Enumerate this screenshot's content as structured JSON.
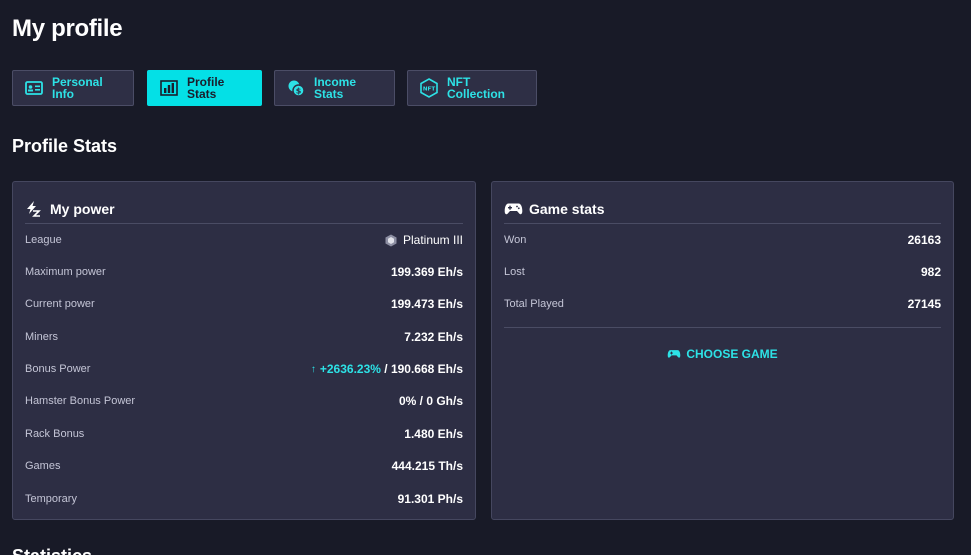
{
  "page": {
    "title": "My profile"
  },
  "tabs": [
    {
      "label": "Personal\nInfo",
      "icon": "id-card-icon",
      "active": false
    },
    {
      "label": "Profile\nStats",
      "icon": "bar-chart-icon",
      "active": true
    },
    {
      "label": "Income\nStats",
      "icon": "coins-icon",
      "active": false
    },
    {
      "label": "NFT\nCollection",
      "icon": "nft-icon",
      "active": false
    }
  ],
  "section": {
    "title": "Profile Stats"
  },
  "power": {
    "title": "My power",
    "rows": [
      {
        "label": "League",
        "value": "Platinum III"
      },
      {
        "label": "Maximum power",
        "value": "199.369 Eh/s"
      },
      {
        "label": "Current power",
        "value": "199.473 Eh/s"
      },
      {
        "label": "Miners",
        "value": "7.232 Eh/s"
      },
      {
        "label": "Bonus Power",
        "bonus_arrow": "↑",
        "bonus_percent": "+2636.23%",
        "value": " / 190.668 Eh/s"
      },
      {
        "label": "Hamster Bonus Power",
        "value": "0% / 0 Gh/s"
      },
      {
        "label": "Rack Bonus",
        "value": "1.480 Eh/s"
      },
      {
        "label": "Games",
        "value": "444.215 Th/s"
      },
      {
        "label": "Temporary",
        "value": "91.301 Ph/s"
      }
    ]
  },
  "game": {
    "title": "Game stats",
    "rows": [
      {
        "label": "Won",
        "value": "26163"
      },
      {
        "label": "Lost",
        "value": "982"
      },
      {
        "label": "Total Played",
        "value": "27145"
      }
    ],
    "choose_label": "CHOOSE GAME"
  },
  "next_section": {
    "title": "Statistics"
  },
  "colors": {
    "accent": "#04e0e6",
    "background": "#181a27",
    "card": "#2d2e44"
  }
}
